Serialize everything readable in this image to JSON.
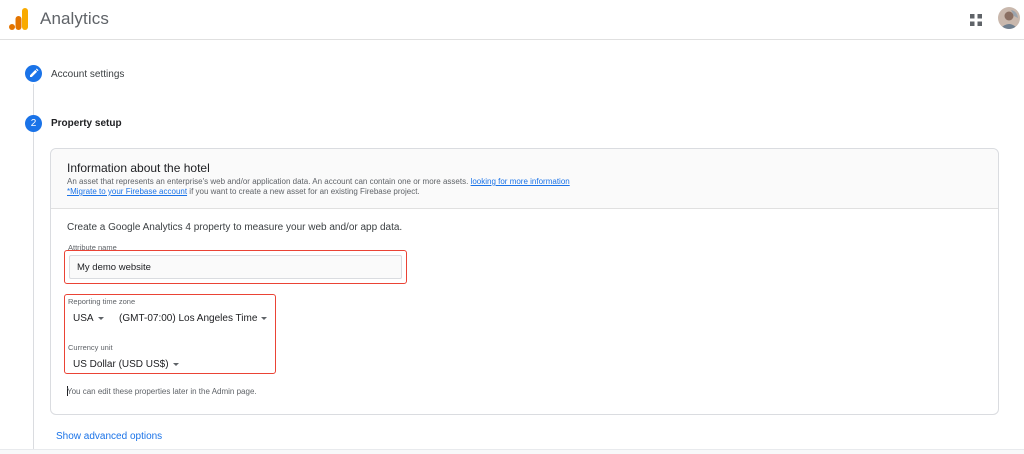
{
  "app": {
    "title": "Analytics"
  },
  "steps": [
    {
      "number": "",
      "label": "Account settings",
      "icon": "pencil-icon"
    },
    {
      "number": "2",
      "label": "Property setup"
    }
  ],
  "card": {
    "title": "Information about the hotel",
    "description_line1": "An asset that represents an enterprise's web and/or application data. An account can contain one or more assets.",
    "more_info_link": "looking for more information",
    "migrate_link": "*Migrate to your Firebase account",
    "description_line2": "if you want to create a new asset for an existing Firebase project.",
    "intro": "Create a Google Analytics 4 property to measure your web and/or app data.",
    "attribute_name_label": "Attribute name",
    "attribute_name_value": "My demo website",
    "timezone_label": "Reporting time zone",
    "country_value": "USA",
    "timezone_value": "(GMT-07:00) Los Angeles Time",
    "currency_label": "Currency unit",
    "currency_value": "US Dollar (USD US$)",
    "note": "You can edit these properties later in the Admin page."
  },
  "advanced_link": "Show advanced options",
  "colors": {
    "accent": "#1a73e8",
    "highlight_border": "#ea4335",
    "logo_orange": "#f9ab00",
    "logo_dark_orange": "#e37400"
  }
}
